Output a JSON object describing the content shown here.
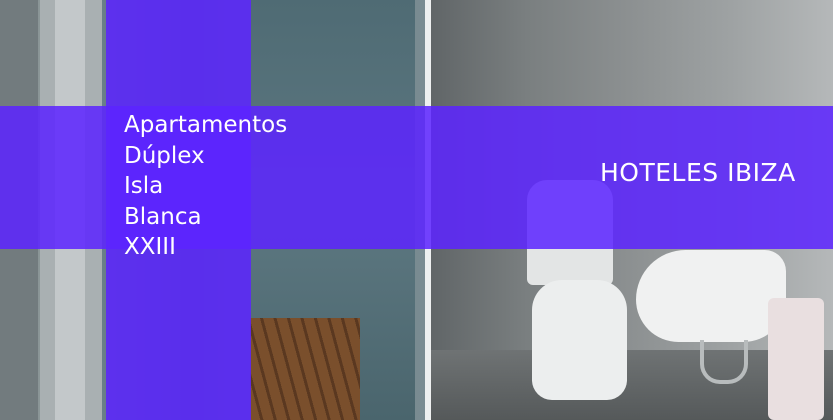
{
  "hotel": {
    "name_lines": [
      "Apartamentos",
      "Dúplex",
      "Isla",
      "Blanca",
      "XXIII"
    ]
  },
  "brand": {
    "label": "HOTELES IBIZA"
  },
  "colors": {
    "banner_purple": "#5c24ff",
    "text": "#ffffff"
  }
}
